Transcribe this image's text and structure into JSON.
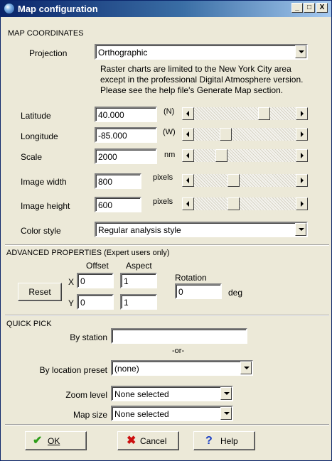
{
  "window": {
    "title": "Map configuration",
    "controls": {
      "minimize": "_",
      "maximize": "□",
      "close": "X"
    }
  },
  "map_coordinates": {
    "section_title": "MAP COORDINATES",
    "projection": {
      "label": "Projection",
      "value": "Orthographic"
    },
    "note_lines": [
      "Raster charts are limited to the New York City area",
      "except in the professional Digital Atmosphere version.",
      "Please see the help file's Generate Map section."
    ],
    "latitude": {
      "label": "Latitude",
      "value": "40.000",
      "unit": "(N)"
    },
    "longitude": {
      "label": "Longitude",
      "value": "-85.000",
      "unit": "(W)"
    },
    "scale": {
      "label": "Scale",
      "value": "2000",
      "unit": "nm"
    },
    "image_width": {
      "label": "Image width",
      "value": "800",
      "unit": "pixels"
    },
    "image_height": {
      "label": "Image height",
      "value": "600",
      "unit": "pixels"
    },
    "color_style": {
      "label": "Color style",
      "value": "Regular analysis style"
    }
  },
  "advanced": {
    "section_title": "ADVANCED PROPERTIES (Expert users only)",
    "offset_label": "Offset",
    "aspect_label": "Aspect",
    "rotation_label": "Rotation",
    "x_label": "X",
    "y_label": "Y",
    "offset_x": "0",
    "offset_y": "0",
    "aspect_x": "1",
    "aspect_y": "1",
    "rotation_value": "0",
    "rotation_unit": "deg",
    "reset_label": "Reset"
  },
  "quick_pick": {
    "section_title": "QUICK PICK",
    "by_station_label": "By station",
    "by_station_value": "",
    "or_label": "-or-",
    "by_location_label": "By location preset",
    "by_location_value": "(none)",
    "zoom_label": "Zoom level",
    "zoom_value": "None selected",
    "map_size_label": "Map size",
    "map_size_value": "None selected"
  },
  "buttons": {
    "ok": "OK",
    "cancel": "Cancel",
    "help": "Help"
  },
  "colors": {
    "title_gradient_start": "#0a246a",
    "title_gradient_end": "#a6caf0",
    "dialog_bg": "#ece9d8",
    "ok_check": "#2e9e1b",
    "cancel_x": "#cc1010",
    "help_q": "#1a3fc4"
  }
}
